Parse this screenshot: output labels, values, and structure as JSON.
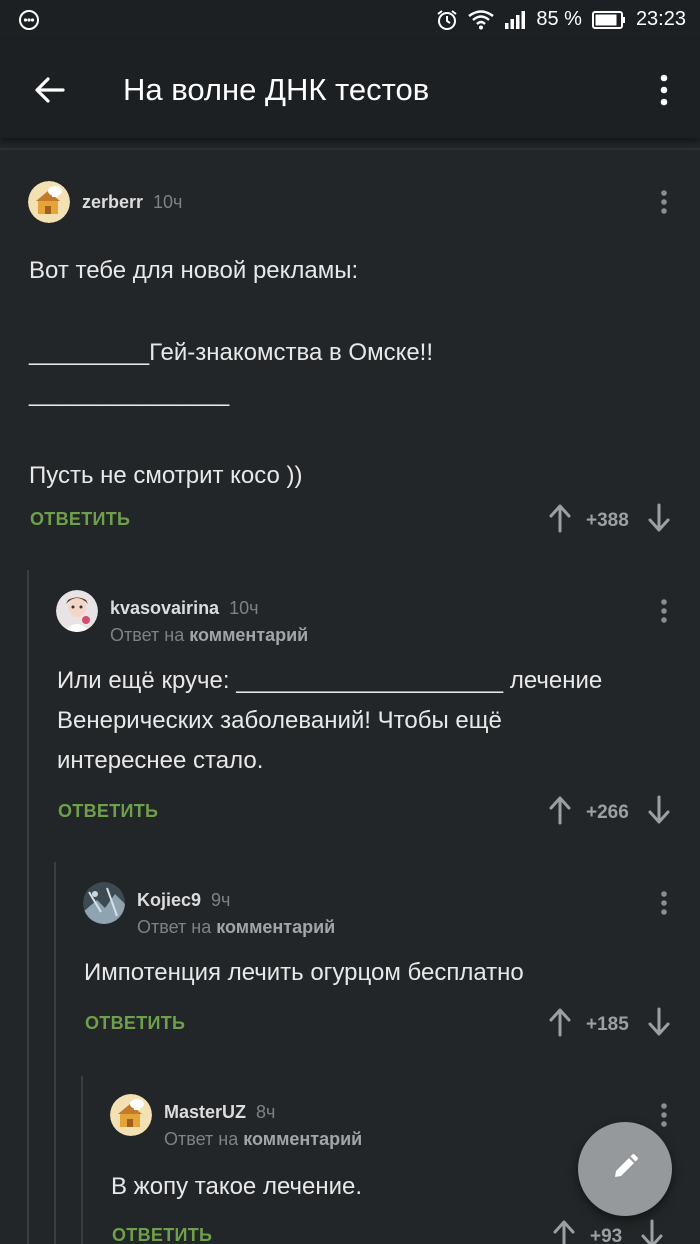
{
  "status_bar": {
    "battery_percent": "85 %",
    "time": "23:23",
    "icons": [
      "notification-icon",
      "alarm-icon",
      "wifi-icon",
      "signal-icon",
      "battery-icon"
    ]
  },
  "app_bar": {
    "title": "На волне ДНК тестов",
    "back_icon": "arrow-left-icon",
    "menu_icon": "more-vertical-icon"
  },
  "comments": [
    {
      "author": "zerberr",
      "time": "10ч",
      "reply_to": null,
      "lines": [
        "Вот тебе для новой рекламы:",
        "",
        "_________Гей-знакомства в Омске!!",
        "_______________",
        "",
        "Пусть не смотрит косо ))"
      ],
      "reply_label": "ОТВЕТИТЬ",
      "score": "+388"
    },
    {
      "author": "kvasovairina",
      "time": "10ч",
      "reply_prefix": "Ответ на",
      "reply_target": "комментарий",
      "lines": [
        "Или ещё круче: ____________________ лечение",
        "Венерических заболеваний! Чтобы ещё",
        "интереснее стало."
      ],
      "reply_label": "ОТВЕТИТЬ",
      "score": "+266"
    },
    {
      "author": "Kojiec9",
      "time": "9ч",
      "reply_prefix": "Ответ на",
      "reply_target": "комментарий",
      "lines": [
        "Импотенция лечить огурцом бесплатно"
      ],
      "reply_label": "ОТВЕТИТЬ",
      "score": "+185"
    },
    {
      "author": "MasterUZ",
      "time": "8ч",
      "reply_prefix": "Ответ на",
      "reply_target": "комментарий",
      "lines": [
        "В жопу такое лечение."
      ],
      "reply_label": "ОТВЕТИТЬ",
      "score": "+93"
    }
  ],
  "fab": {
    "icon": "pencil-icon"
  },
  "colors": {
    "background": "#232628",
    "appbar": "#1d2022",
    "reply_green": "#6ea04b",
    "fab": "#95999c"
  }
}
